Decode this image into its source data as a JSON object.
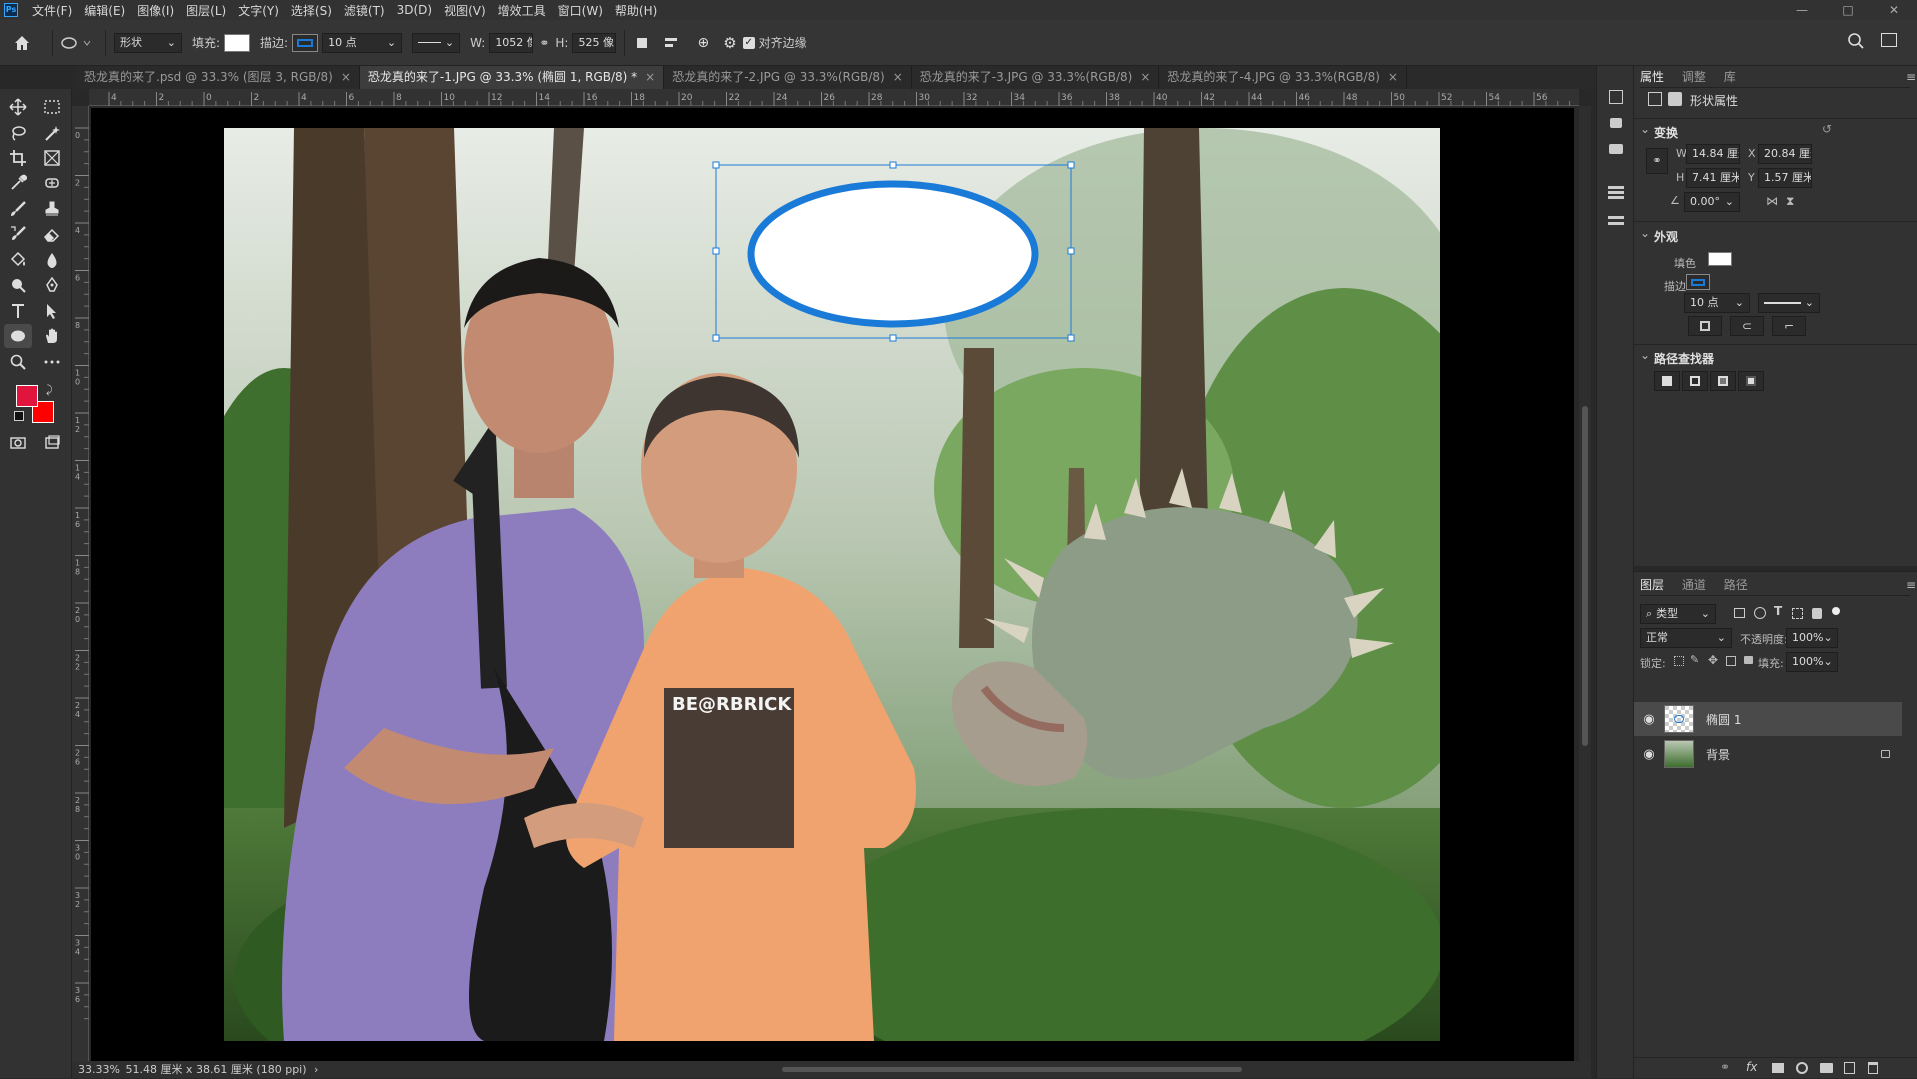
{
  "app": {
    "logo": "Ps",
    "window_controls": [
      "—",
      "□",
      "✕"
    ]
  },
  "menu": [
    "文件(F)",
    "编辑(E)",
    "图像(I)",
    "图层(L)",
    "文字(Y)",
    "选择(S)",
    "滤镜(T)",
    "3D(D)",
    "视图(V)",
    "增效工具",
    "窗口(W)",
    "帮助(H)"
  ],
  "options": {
    "mode": "形状",
    "fill_label": "填充:",
    "stroke_label": "描边:",
    "stroke_width": "10 点",
    "w_label": "W:",
    "w_value": "1052 像",
    "h_label": "H:",
    "h_value": "525 像",
    "align_edges": "对齐边缘"
  },
  "tabs": [
    {
      "label": "恐龙真的来了.psd @ 33.3% (图层 3, RGB/8)",
      "active": false
    },
    {
      "label": "恐龙真的来了-1.JPG @ 33.3% (椭圆 1, RGB/8) *",
      "active": true
    },
    {
      "label": "恐龙真的来了-2.JPG @ 33.3%(RGB/8)",
      "active": false
    },
    {
      "label": "恐龙真的来了-3.JPG @ 33.3%(RGB/8)",
      "active": false
    },
    {
      "label": "恐龙真的来了-4.JPG @ 33.3%(RGB/8)",
      "active": false
    }
  ],
  "ruler_top": [
    "4",
    "2",
    "0",
    "2",
    "4",
    "6",
    "8",
    "10",
    "12",
    "14",
    "16",
    "18",
    "20",
    "22",
    "24",
    "26",
    "28",
    "30",
    "32",
    "34",
    "36",
    "38",
    "40",
    "42",
    "44",
    "46",
    "48",
    "50",
    "52",
    "54",
    "56"
  ],
  "ruler_left": [
    "0",
    "2",
    "4",
    "6",
    "8",
    "1 0",
    "1 2",
    "1 4",
    "1 6",
    "1 8",
    "2 0",
    "2 2",
    "2 4",
    "2 6",
    "2 8",
    "3 0",
    "3 2",
    "3 4",
    "3 6"
  ],
  "status": {
    "zoom": "33.33%",
    "doc": "51.48 厘米 x 38.61 厘米 (180 ppi)"
  },
  "colors": {
    "foreground": "#e0143c",
    "background": "#ff0000",
    "stroke": "#1a7ad8",
    "fill": "#ffffff"
  },
  "properties": {
    "tabs": [
      "属性",
      "调整",
      "库"
    ],
    "title": "形状属性",
    "transform": {
      "section": "变换",
      "w_label": "W",
      "w": "14.84 厘米",
      "x_label": "X",
      "x": "20.84 厘米",
      "h_label": "H",
      "h": "7.41 厘米",
      "y_label": "Y",
      "y": "1.57 厘米",
      "angle": "0.00°"
    },
    "appearance": {
      "section": "外观",
      "fill_label": "填色",
      "stroke_label": "描边",
      "stroke_width": "10 点"
    },
    "pathfinder": {
      "section": "路径查找器"
    }
  },
  "layers": {
    "tabs": [
      "图层",
      "通道",
      "路径"
    ],
    "filter": "类型",
    "blend": "正常",
    "opacity_label": "不透明度:",
    "opacity": "100%",
    "lock_label": "锁定:",
    "fill_label": "填充:",
    "fill": "100%",
    "items": [
      {
        "name": "椭圆 1",
        "selected": true
      },
      {
        "name": "背景",
        "selected": false
      }
    ]
  }
}
